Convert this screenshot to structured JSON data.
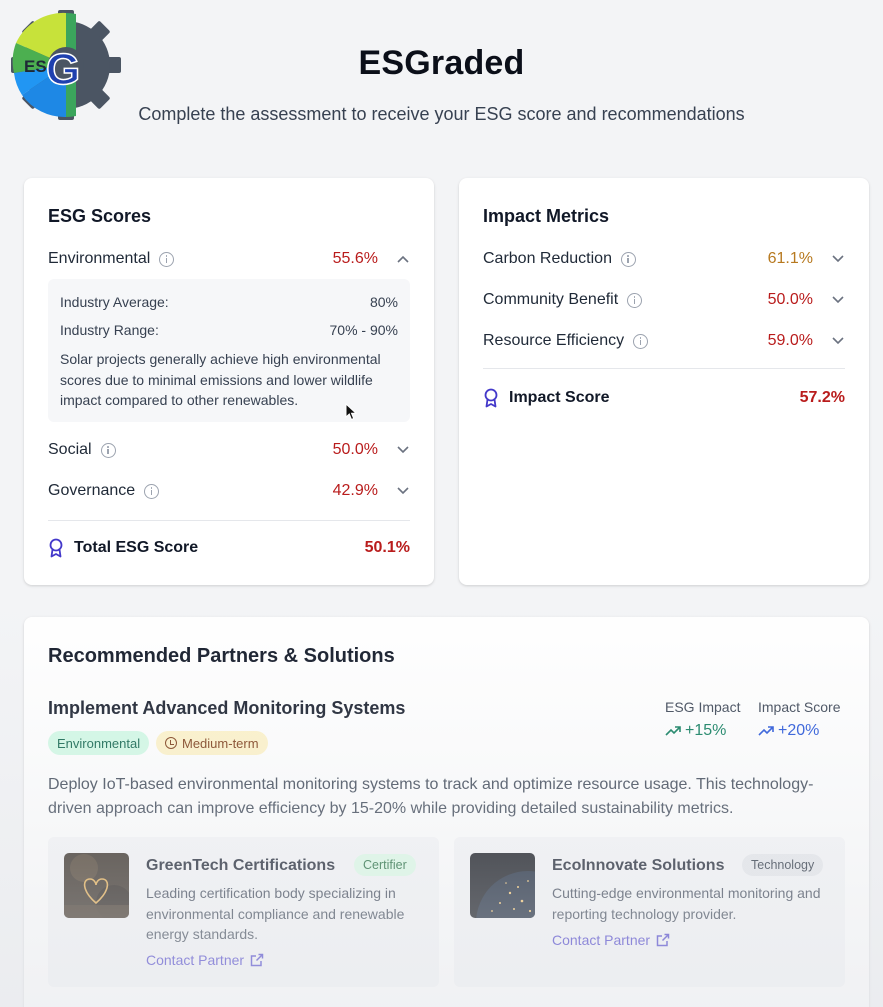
{
  "header": {
    "logo_text": "ESG",
    "title": "ESGraded",
    "subtitle": "Complete the assessment to receive your ESG score and recommendations"
  },
  "esg_scores": {
    "title": "ESG Scores",
    "rows": [
      {
        "label": "Environmental",
        "value": "55.6%",
        "expanded": true
      },
      {
        "label": "Social",
        "value": "50.0%",
        "expanded": false
      },
      {
        "label": "Governance",
        "value": "42.9%",
        "expanded": false
      }
    ],
    "details": {
      "industry_average_label": "Industry Average:",
      "industry_average_value": "80%",
      "industry_range_label": "Industry Range:",
      "industry_range_value": "70% - 90%",
      "description": "Solar projects generally achieve high environmental scores due to minimal emissions and lower wildlife impact compared to other renewables."
    },
    "total_label": "Total ESG Score",
    "total_value": "50.1%"
  },
  "impact_metrics": {
    "title": "Impact Metrics",
    "rows": [
      {
        "label": "Carbon Reduction",
        "value": "61.1%",
        "color": "#b7791f"
      },
      {
        "label": "Community Benefit",
        "value": "50.0%",
        "color": "#b91c1c"
      },
      {
        "label": "Resource Efficiency",
        "value": "59.0%",
        "color": "#b91c1c"
      }
    ],
    "total_label": "Impact Score",
    "total_value": "57.2%"
  },
  "recommendations": {
    "title": "Recommended Partners & Solutions",
    "item_title": "Implement Advanced Monitoring Systems",
    "tags": [
      "Environmental",
      "Medium-term"
    ],
    "esg_impact_label": "ESG Impact",
    "esg_impact_value": "+15%",
    "impact_score_label": "Impact Score",
    "impact_score_value": "+20%",
    "description": "Deploy IoT-based environmental monitoring systems to track and optimize resource usage. This technology-driven approach can improve efficiency by 15-20% while providing detailed sustainability metrics.",
    "partners": [
      {
        "name": "GreenTech Certifications",
        "badge": "Certifier",
        "description": "Leading certification body specializing in environmental compliance and renewable energy standards.",
        "link": "Contact Partner"
      },
      {
        "name": "EcoInnovate Solutions",
        "badge": "Technology",
        "description": "Cutting-edge environmental monitoring and reporting technology provider.",
        "link": "Contact Partner"
      }
    ]
  },
  "colors": {
    "score_red": "#b91c1c",
    "score_amber": "#b7791f",
    "positive_green": "#047857",
    "positive_blue": "#1d4ed8",
    "link": "#4338ca",
    "award_icon": "#4338ca"
  }
}
